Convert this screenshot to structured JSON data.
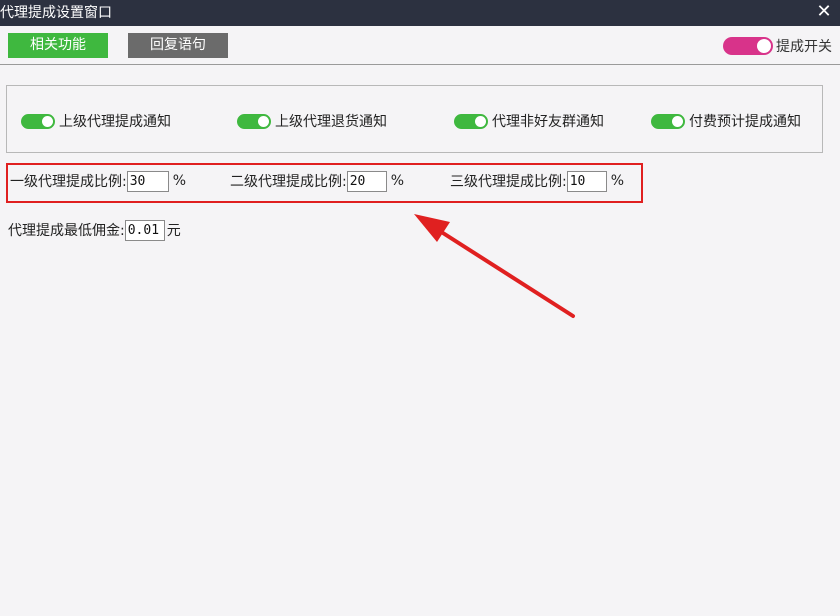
{
  "window": {
    "title": "代理提成设置窗口",
    "close_label": "✕"
  },
  "toolbar": {
    "related_label": "相关功能",
    "reply_label": "回复语句",
    "master_switch_label": "提成开关",
    "master_switch_on": true
  },
  "notifications": {
    "items": [
      {
        "label": "上级代理提成通知",
        "on": true
      },
      {
        "label": "上级代理退货通知",
        "on": true
      },
      {
        "label": "代理非好友群通知",
        "on": true
      },
      {
        "label": "付费预计提成通知",
        "on": true
      }
    ]
  },
  "ratios": {
    "level1": {
      "label": "一级代理提成比例:",
      "value": "30",
      "unit": "%"
    },
    "level2": {
      "label": "二级代理提成比例:",
      "value": "20",
      "unit": "%"
    },
    "level3": {
      "label": "三级代理提成比例:",
      "value": "10",
      "unit": "%"
    }
  },
  "commission": {
    "label": "代理提成最低佣金:",
    "value": "0.01",
    "unit": "元"
  },
  "colors": {
    "titlebar": "#2c3140",
    "green": "#3fb83f",
    "gray_button": "#6b6b6b",
    "pink": "#d8338a",
    "annotation_red": "#e02020"
  }
}
